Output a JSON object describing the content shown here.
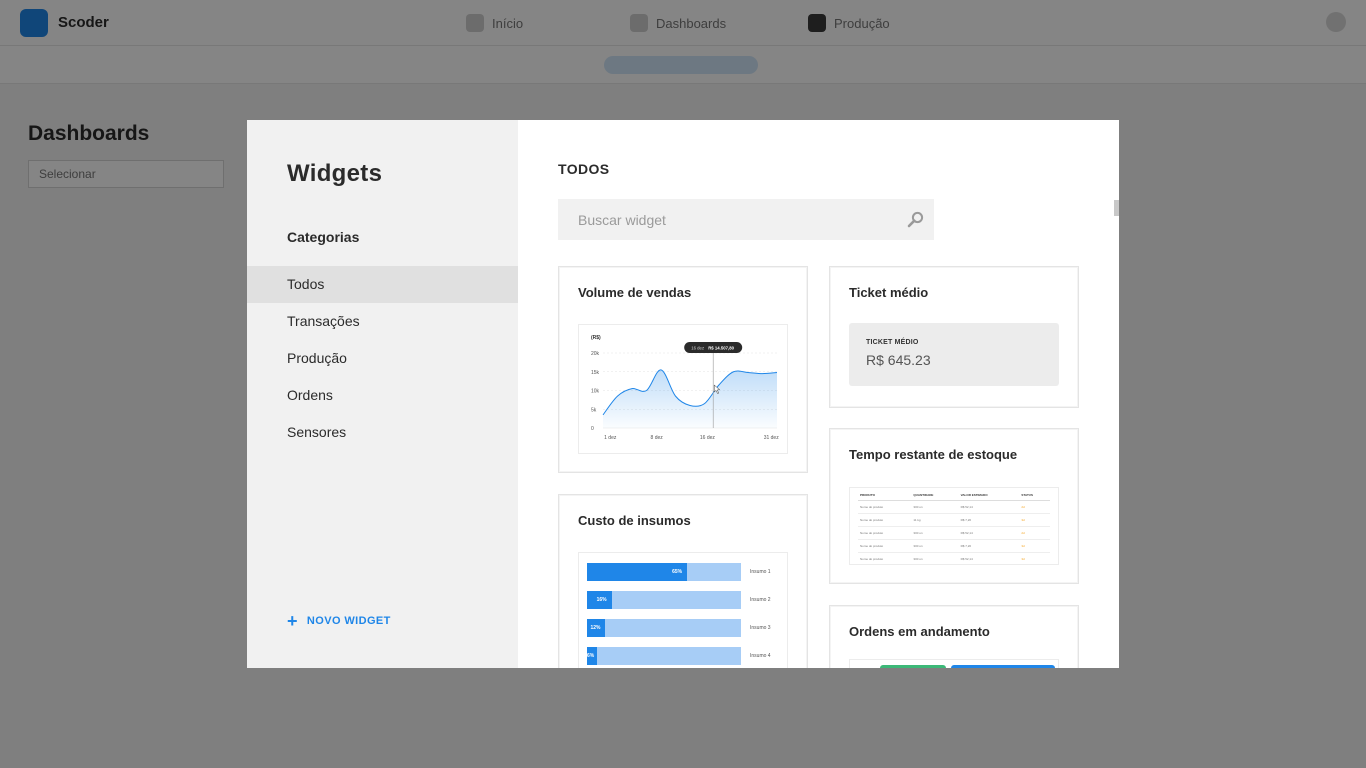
{
  "background": {
    "app_name": "Scoder",
    "nav": [
      "Início",
      "Dashboards",
      "Produção"
    ],
    "page_title": "Dashboards",
    "page_select": "Selecionar"
  },
  "modal": {
    "sidebar": {
      "title": "Widgets",
      "categories_label": "Categorias",
      "categories": [
        "Todos",
        "Transações",
        "Produção",
        "Ordens",
        "Sensores"
      ],
      "active_category": "Todos",
      "new_widget_label": "NOVO WIDGET"
    },
    "content": {
      "heading": "TODOS",
      "search": {
        "placeholder": "Buscar widget",
        "value": ""
      },
      "cards": {
        "sales_volume": {
          "title": "Volume de vendas",
          "chart_data": {
            "type": "area",
            "ylabel": "(R$)",
            "x_ticks": [
              "1 dez",
              "8 dez",
              "16 dez",
              "31 dez"
            ],
            "y_ticks": [
              "0",
              "5k",
              "10k",
              "15k",
              "20k"
            ],
            "ylim": [
              0,
              20000
            ],
            "x": [
              0,
              1,
              2,
              3,
              4,
              5,
              6,
              7,
              8,
              9,
              10,
              11,
              12
            ],
            "values": [
              3500,
              8500,
              10500,
              10000,
              15500,
              8500,
              6000,
              6500,
              11500,
              15000,
              14800,
              14500,
              14800
            ],
            "tooltip": {
              "date": "16 dez",
              "value": "R$ 14.507,80",
              "x": 7.6
            }
          }
        },
        "ticket": {
          "title": "Ticket médio",
          "label": "TICKET MÉDIO",
          "value": "R$ 645.23"
        },
        "stock_time": {
          "title": "Tempo restante de estoque",
          "columns": [
            "PRODUTO",
            "QUANTIDADE",
            "VALOR ESTIMADO",
            "STATUS"
          ],
          "rows": [
            [
              "Nome do produto",
              "300 un",
              "R$ 52,14",
              "2d"
            ],
            [
              "Nome do produto",
              "11 kg",
              "R$ 7,20",
              "3d"
            ],
            [
              "Nome do produto",
              "300 un",
              "R$ 52,14",
              "2d"
            ],
            [
              "Nome do produto",
              "300 un",
              "R$ 7,20",
              "3d"
            ],
            [
              "Nome do produto",
              "300 un",
              "R$ 52,14",
              "3d"
            ]
          ]
        },
        "input_cost": {
          "title": "Custo de insumos",
          "chart_data": {
            "type": "bar",
            "categories": [
              "Insumo 1",
              "Insumo 2",
              "Insumo 3",
              "Insumo 4"
            ],
            "values": [
              65,
              16,
              12,
              6
            ],
            "value_labels": [
              "65%",
              "16%",
              "12%",
              "6%"
            ],
            "ylim": [
              0,
              100
            ]
          }
        },
        "orders": {
          "title": "Ordens em andamento"
        }
      }
    }
  },
  "colors": {
    "accent": "#1f86e8",
    "accent_light": "#a7cdf6",
    "orders_green": "#3cb878",
    "status_orange": "#f5a623"
  }
}
